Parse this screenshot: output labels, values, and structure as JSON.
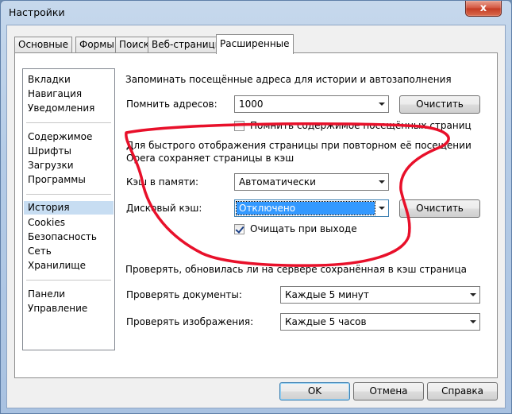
{
  "window": {
    "title": "Настройки",
    "close_glyph": "x"
  },
  "tabs": [
    "Основные",
    "Формы",
    "Поиск",
    "Веб-страницы",
    "Расширенные"
  ],
  "sidebar": {
    "items": [
      "Вкладки",
      "Навигация",
      "Уведомления",
      "Содержимое",
      "Шрифты",
      "Загрузки",
      "Программы",
      "История",
      "Cookies",
      "Безопасность",
      "Сеть",
      "Хранилище",
      "Панели",
      "Управление"
    ],
    "selected": "История"
  },
  "history": {
    "heading": "Запоминать посещённые адреса для истории и автозаполнения",
    "remember_label": "Помнить адресов:",
    "remember_value": "1000",
    "clear_button": "Очистить",
    "remember_content_label": "Помнить содержимое посещённых страниц",
    "remember_content_checked": false
  },
  "cache": {
    "description_line1": "Для быстрого отображения страницы при повторном её посещении",
    "description_line2": "Opera сохраняет страницы в кэш",
    "memory_label": "Кэш в памяти:",
    "memory_value": "Автоматически",
    "disk_label": "Дисковый кэш:",
    "disk_value": "Отключено",
    "clear_button": "Очистить",
    "clear_on_exit_label": "Очищать при выходе",
    "clear_on_exit_checked": true
  },
  "check": {
    "heading": "Проверять, обновилась ли на сервере сохранённая в кэш страница",
    "documents_label": "Проверять документы:",
    "documents_value": "Каждые 5 минут",
    "images_label": "Проверять изображения:",
    "images_value": "Каждые 5 часов"
  },
  "footer": {
    "ok": "OK",
    "cancel": "Отмена",
    "help": "Справка"
  },
  "colors": {
    "annotation": "#e8102a",
    "selection": "#3399ff",
    "sidebar_selected": "#c7ddf2"
  }
}
